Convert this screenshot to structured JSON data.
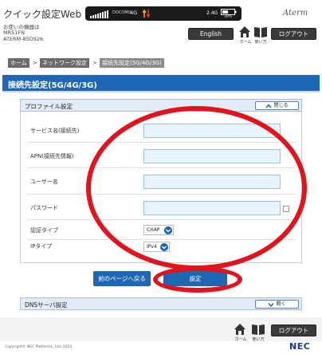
{
  "header": {
    "title": "クイック設定Web",
    "device_info": [
      "お使いの機器は",
      "MR51FN",
      "ATERM-85D926"
    ],
    "status": {
      "carrier": "DOCOMO",
      "network_type": "4G",
      "band": "2.4G",
      "battery_percent": "39%"
    },
    "brand_logo": "Aterm",
    "english_label": "English",
    "home_label": "ホーム",
    "manual_label": "使い方",
    "logout_label": "ログアウト"
  },
  "breadcrumb": [
    {
      "label": "ホーム"
    },
    {
      "label": "ネットワーク設定"
    },
    {
      "label": "接続先設定(5G/4G/3G)"
    }
  ],
  "breadcrumb_separator": ">",
  "page_title": "接続先設定(5G/4G/3G)",
  "profile_section": {
    "title": "プロファイル設定",
    "toggle_label": "閉じる",
    "fields": {
      "service_name_label": "サービス名(接続先)",
      "service_name_value": "",
      "apn_label": "APN(接続先情報)",
      "apn_value": "",
      "username_label": "ユーザー名",
      "username_value": "",
      "password_label": "パスワード",
      "password_value": "",
      "auth_type_label": "認証タイプ",
      "auth_type_value": "CHAP",
      "ip_type_label": "IPタイプ",
      "ip_type_value": "IPv4"
    }
  },
  "actions": {
    "back_label": "前のページへ戻る",
    "set_label": "設定"
  },
  "dns_section": {
    "title": "DNSサーバ設定",
    "toggle_label": "開く"
  },
  "footer": {
    "home_label": "ホーム",
    "manual_label": "使い方",
    "logout_label": "ログアウト",
    "copyright": "Copyright© NEC Platforms, Ltd. 2023",
    "company_logo": "NEC"
  },
  "colors": {
    "primary": "#1f66b5",
    "section_header": "#e3ecf6",
    "input_bg": "#e9f3fb",
    "annotation": "#e0141e"
  },
  "icons": [
    "signal-icon",
    "traffic-icon",
    "battery-icon",
    "home-icon",
    "manual-icon",
    "chevron-up-icon",
    "chevron-down-icon"
  ]
}
